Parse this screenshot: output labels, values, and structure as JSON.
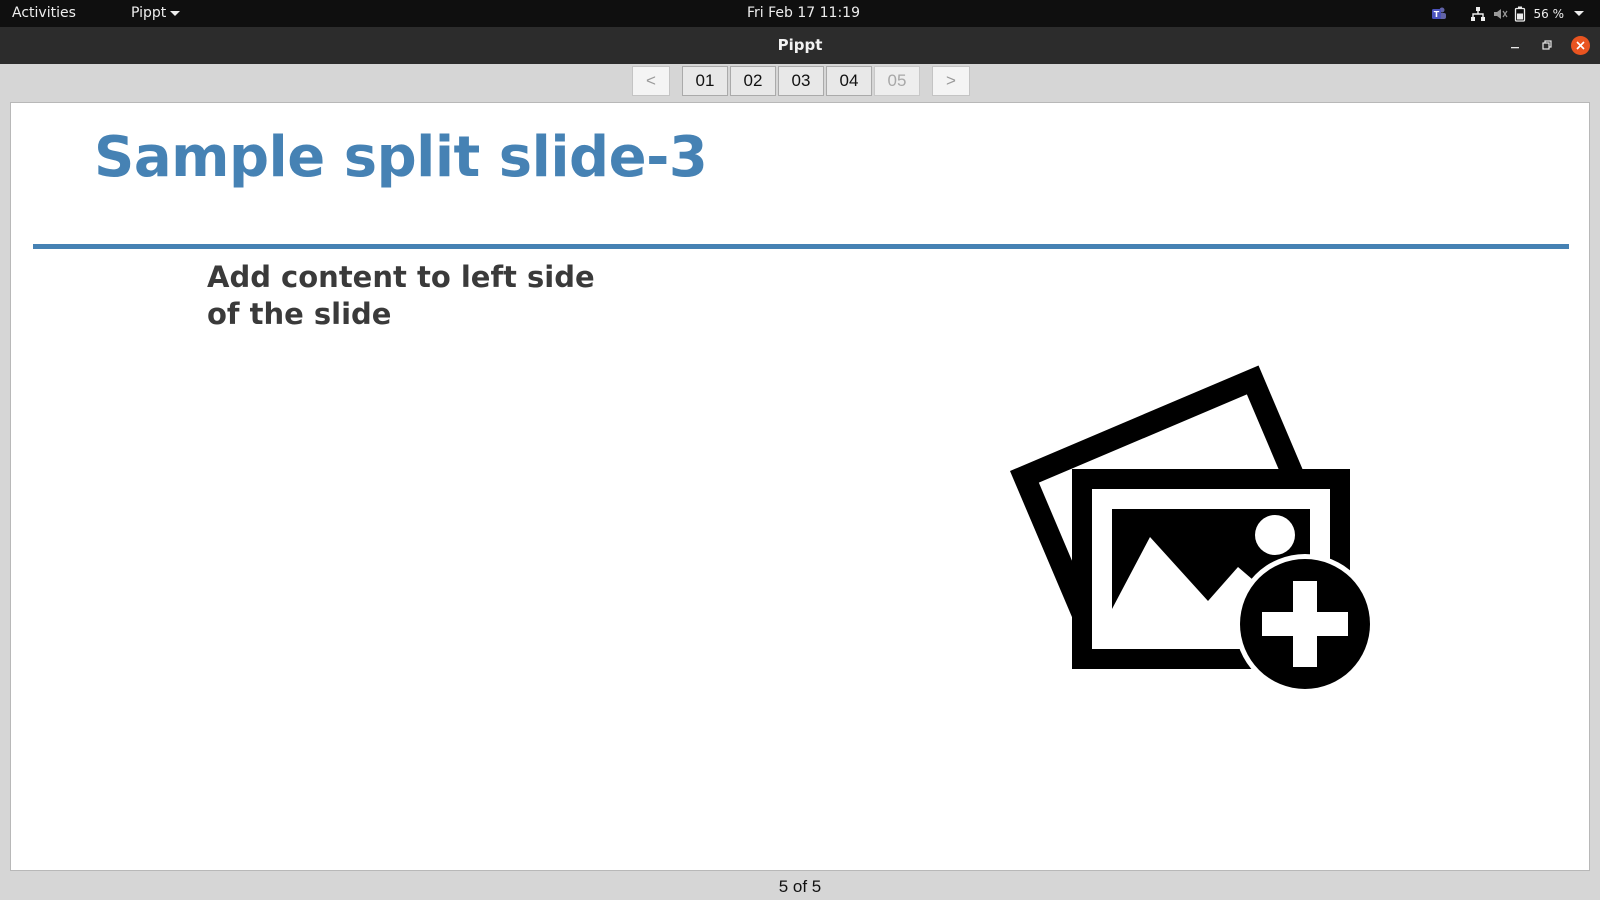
{
  "topbar": {
    "activities": "Activities",
    "app_menu": "Pippt",
    "clock": "Fri Feb 17  11:19",
    "battery": "56 %",
    "icons": [
      "teams-icon",
      "network-icon",
      "volume-muted-icon",
      "battery-icon",
      "chevron-down-icon"
    ]
  },
  "window": {
    "title": "Pippt",
    "controls": [
      "minimize",
      "maximize",
      "close"
    ],
    "close_color": "#e95420"
  },
  "navigation": {
    "prev_label": "<",
    "next_label": ">",
    "slides": [
      "01",
      "02",
      "03",
      "04",
      "05"
    ],
    "current_slide": "05"
  },
  "slide": {
    "title": "Sample split slide-3",
    "left_content": "Add content to left side of the slide",
    "image_placeholder_icon": "add-image-icon",
    "accent_color": "#4682b4"
  },
  "status": {
    "page_indicator": "5 of 5"
  }
}
